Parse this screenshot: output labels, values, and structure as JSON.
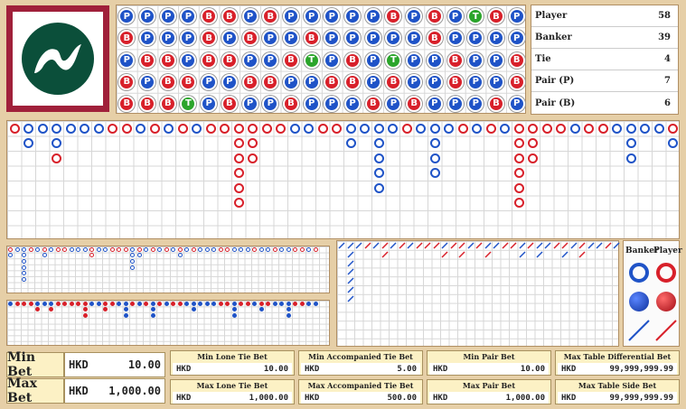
{
  "stats": [
    {
      "label": "Player",
      "value": "58"
    },
    {
      "label": "Banker",
      "value": "39"
    },
    {
      "label": "Tie",
      "value": "4"
    },
    {
      "label": "Pair (P)",
      "value": "7"
    },
    {
      "label": "Pair (B)",
      "value": "6"
    }
  ],
  "bead_plate": [
    "PPPPBBPBPPPPPBPBPTBP",
    "BPPPBPBPPBPPPPPBPPPP",
    "PBBPBBPPBTPBPTPPBPPB",
    "BPBBPPBBPPBBPBPPBPPB",
    "BBBTPBPPBPPPBPBPPPBP"
  ],
  "legend": {
    "banker": "Banker",
    "player": "Player"
  },
  "min_bet": {
    "label": "Min Bet",
    "currency": "HKD",
    "value": "10.00"
  },
  "max_bet": {
    "label": "Max Bet",
    "currency": "HKD",
    "value": "1,000.00"
  },
  "limits": [
    {
      "title": "Min Lone Tie Bet",
      "currency": "HKD",
      "value": "10.00"
    },
    {
      "title": "Min Accompanied Tie Bet",
      "currency": "HKD",
      "value": "5.00"
    },
    {
      "title": "Min Pair Bet",
      "currency": "HKD",
      "value": "10.00"
    },
    {
      "title": "Max Table Differential Bet",
      "currency": "HKD",
      "value": "99,999,999.99"
    },
    {
      "title": "Max Lone Tie Bet",
      "currency": "HKD",
      "value": "1,000.00"
    },
    {
      "title": "Max Accompanied Tie Bet",
      "currency": "HKD",
      "value": "500.00"
    },
    {
      "title": "Max Pair Bet",
      "currency": "HKD",
      "value": "1,000.00"
    },
    {
      "title": "Max Table Side Bet",
      "currency": "HKD",
      "value": "99,999,999.99"
    }
  ],
  "colors": {
    "banker": "#d8202a",
    "player": "#1f53c7",
    "tie": "#2ba52b",
    "frame": "#a0203a",
    "logo_green": "#0b4f3a"
  }
}
